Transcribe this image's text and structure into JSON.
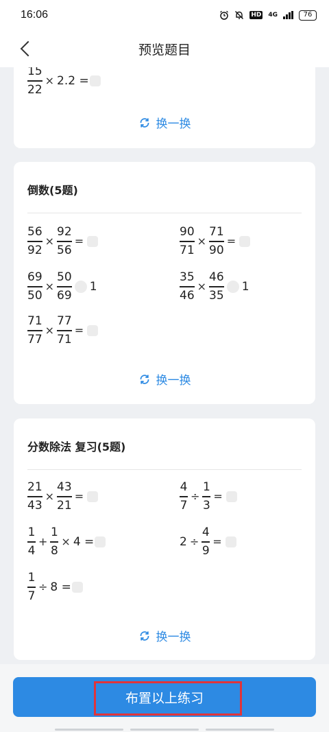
{
  "status_bar": {
    "time": "16:06",
    "hd": "HD",
    "network": "4G",
    "battery": "76"
  },
  "nav": {
    "title": "预览题目"
  },
  "swap_label": "换一换",
  "sections": {
    "top": {
      "q1": {
        "num": "15",
        "den": "22",
        "op": "×",
        "rest": "2.2 ="
      }
    },
    "reciprocal": {
      "title": "倒数(5题)",
      "q1": {
        "a_num": "56",
        "a_den": "92",
        "op": "×",
        "b_num": "92",
        "b_den": "56",
        "eq": "="
      },
      "q2": {
        "a_num": "90",
        "a_den": "71",
        "op": "×",
        "b_num": "71",
        "b_den": "90",
        "eq": "="
      },
      "q3": {
        "a_num": "69",
        "a_den": "50",
        "op": "×",
        "b_num": "50",
        "b_den": "69",
        "rhs": "1"
      },
      "q4": {
        "a_num": "35",
        "a_den": "46",
        "op": "×",
        "b_num": "46",
        "b_den": "35",
        "rhs": "1"
      },
      "q5": {
        "a_num": "71",
        "a_den": "77",
        "op": "×",
        "b_num": "77",
        "b_den": "71",
        "eq": "="
      }
    },
    "division": {
      "title": "分数除法 复习(5题)",
      "q1": {
        "a_num": "21",
        "a_den": "43",
        "op": "×",
        "b_num": "43",
        "b_den": "21",
        "eq": "="
      },
      "q2": {
        "a_num": "4",
        "a_den": "7",
        "op": "÷",
        "b_num": "1",
        "b_den": "3",
        "eq": "="
      },
      "q3": {
        "a_num": "1",
        "a_den": "4",
        "op1": "+",
        "b_num": "1",
        "b_den": "8",
        "op2": "×",
        "rest": "4 ="
      },
      "q4": {
        "lead": "2",
        "op": "÷",
        "b_num": "4",
        "b_den": "9",
        "eq": "="
      },
      "q5": {
        "a_num": "1",
        "a_den": "7",
        "op": "÷",
        "rest": "8 ="
      }
    }
  },
  "footer": {
    "button_label": "布置以上练习"
  }
}
